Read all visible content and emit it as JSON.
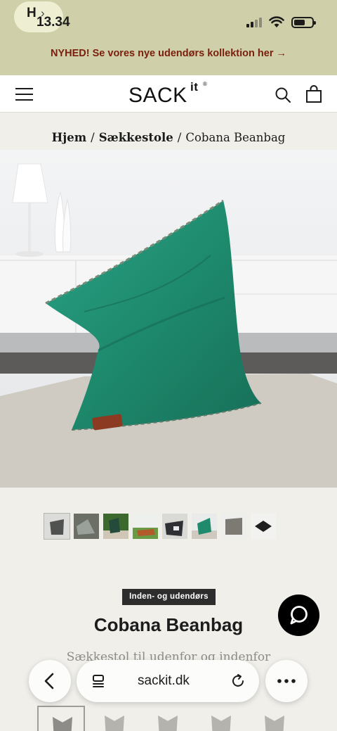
{
  "status_bar": {
    "back_app_letter": "H",
    "time": "13.34"
  },
  "announcement": {
    "text": "NYHED! Se vores nye udendørs kollektion her →"
  },
  "header": {
    "logo_text": "SACK",
    "logo_sup": "it",
    "logo_reg": "®",
    "icons": [
      "menu-icon",
      "search-icon",
      "bag-icon"
    ]
  },
  "breadcrumb": {
    "home": "Hjem",
    "category": "Sækkestole",
    "current": "Cobana Beanbag",
    "separator": "/"
  },
  "product": {
    "tag": "Inden- og udendørs",
    "title": "Cobana Beanbag",
    "subtitle": "Sækkestol til udenfor og indenfor",
    "colors": {
      "fabric": "#1f8a6c",
      "tag_bg": "#2d2d2d"
    }
  },
  "browser": {
    "url": "sackit.dk",
    "icons": [
      "back-chevron-icon",
      "tabs-icon",
      "reload-icon",
      "more-icon"
    ]
  },
  "colors": {
    "top_tint": "#cfcfa9",
    "announcement_text": "#7a1f0d",
    "page_bg": "#f0efea"
  }
}
